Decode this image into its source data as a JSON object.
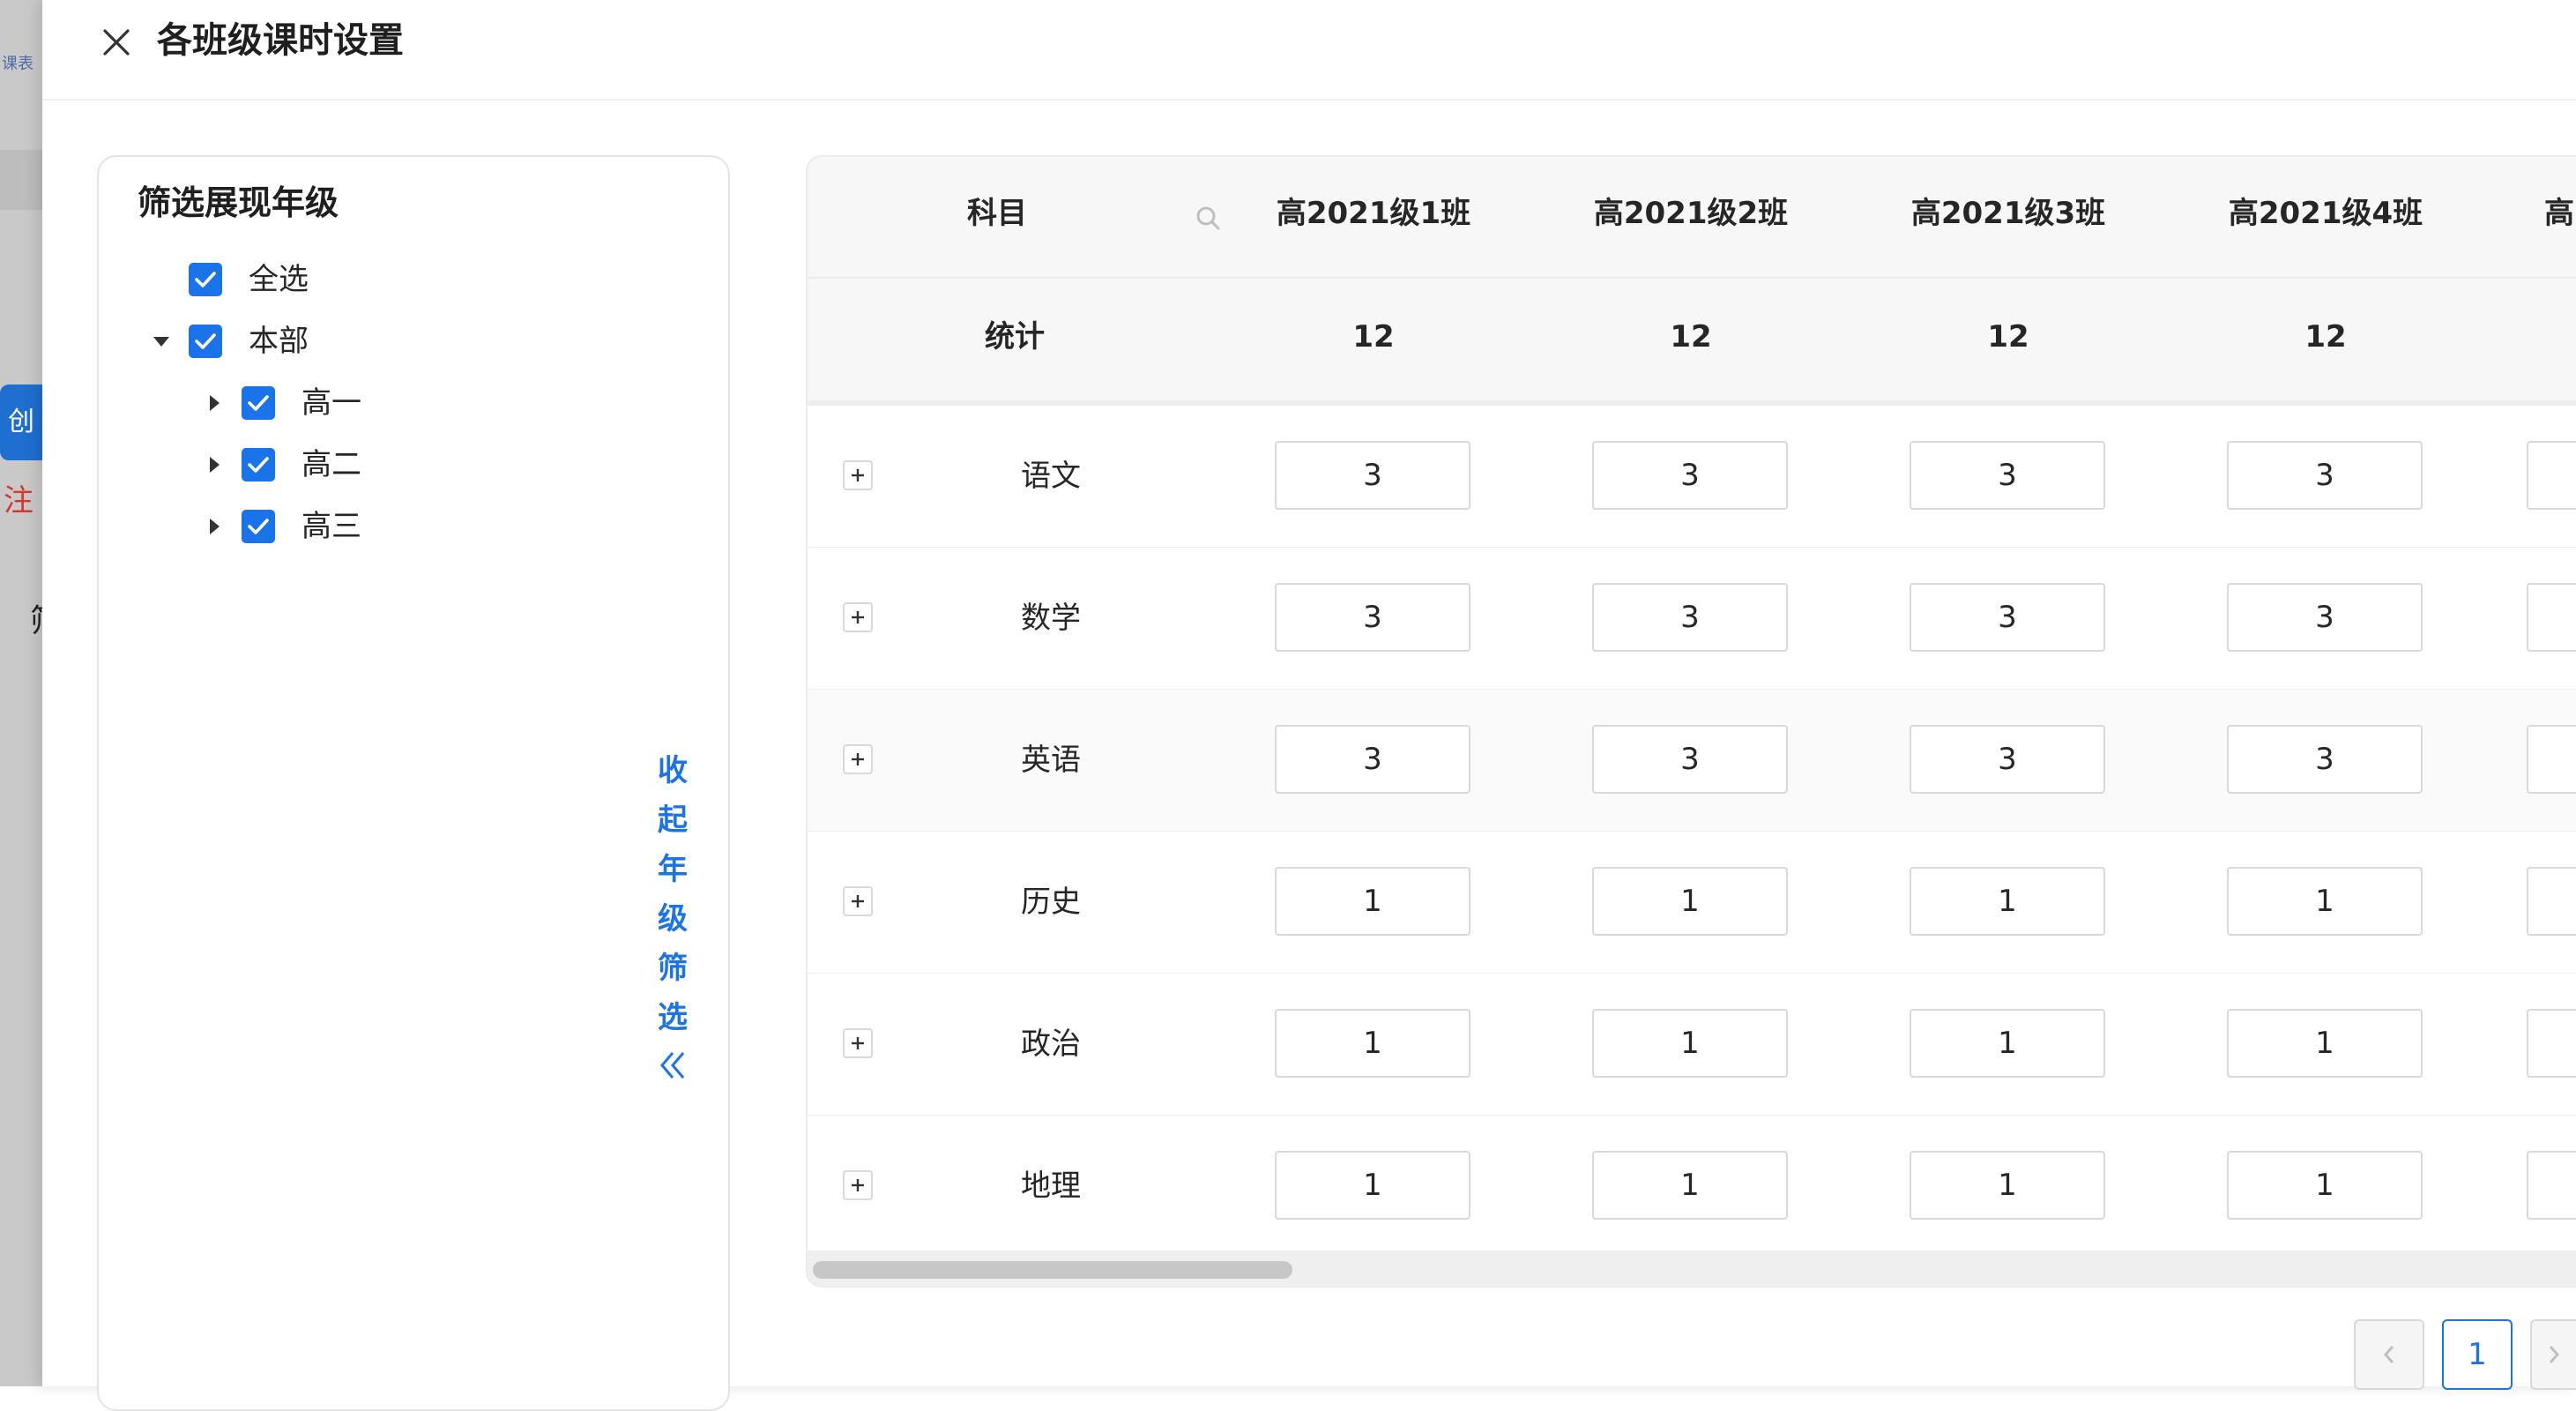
{
  "background": {
    "logo_text": "课表",
    "button_char": "创",
    "red_text": "注",
    "dark_char": "筛"
  },
  "drawer": {
    "title": "各班级课时设置"
  },
  "filter": {
    "title": "筛选展现年级",
    "select_all": "全选",
    "root": "本部",
    "grades": [
      "高一",
      "高二",
      "高三"
    ],
    "collapse_chars": [
      "收",
      "起",
      "年",
      "级",
      "筛",
      "选"
    ]
  },
  "table": {
    "subject_header": "科目",
    "class_headers": [
      "高2021级1班",
      "高2021级2班",
      "高2021级3班",
      "高2021级4班",
      "高"
    ],
    "stat_label": "统计",
    "stat_values": [
      "12",
      "12",
      "12",
      "12"
    ],
    "rows": [
      {
        "subject": "语文",
        "values": [
          "3",
          "3",
          "3",
          "3"
        ]
      },
      {
        "subject": "数学",
        "values": [
          "3",
          "3",
          "3",
          "3"
        ]
      },
      {
        "subject": "英语",
        "values": [
          "3",
          "3",
          "3",
          "3"
        ]
      },
      {
        "subject": "历史",
        "values": [
          "1",
          "1",
          "1",
          "1"
        ]
      },
      {
        "subject": "政治",
        "values": [
          "1",
          "1",
          "1",
          "1"
        ]
      },
      {
        "subject": "地理",
        "values": [
          "1",
          "1",
          "1",
          "1"
        ]
      }
    ]
  },
  "pagination": {
    "current_page": "1"
  },
  "colors": {
    "accent": "#1a73e8",
    "text": "#262626",
    "border": "#d9d9d9"
  }
}
